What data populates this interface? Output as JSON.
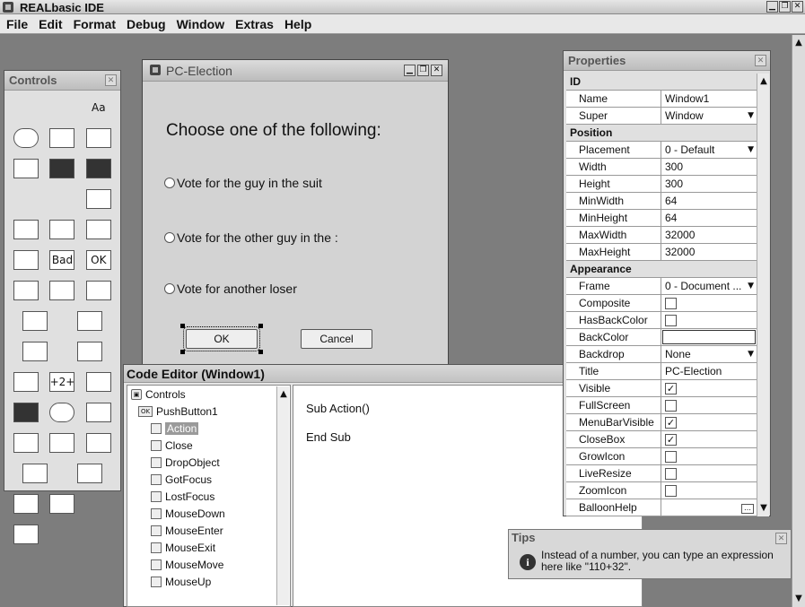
{
  "app": {
    "title": "REALbasic IDE"
  },
  "menu": [
    "File",
    "Edit",
    "Format",
    "Debug",
    "Window",
    "Extras",
    "Help"
  ],
  "palette": {
    "title": "Controls",
    "rows": [
      [
        "line-tool",
        "line-icon",
        "text-label-icon"
      ],
      [
        "oval-icon",
        "rounded-rect-icon",
        "rectangle-icon"
      ],
      [
        "canvas-icon",
        "imagewell-icon",
        "image-icon"
      ],
      [
        "disclosure-icon",
        "disclosure-open-icon",
        "editfield-icon"
      ],
      [
        "scrollbar-icon",
        "popup-menu-icon",
        "slider-icon"
      ],
      [
        "up-down-arrows-icon",
        "bevel-button-icon",
        "push-button-icon"
      ],
      [
        "combobox-icon",
        "listbox-icon",
        "listbox-columns-icon"
      ],
      [
        "checkbox-icon",
        "radio-button-icon"
      ],
      [
        "progress-wheel-icon",
        "progress-bar-icon"
      ],
      [
        "groupbox-icon",
        "tab-panel-icon",
        "page-panel-icon"
      ],
      [
        "movie-icon",
        "ball-icon",
        "timer-display-icon"
      ],
      [
        "serial-icon",
        "tabpanel-icon",
        "contextual-icon"
      ],
      [
        "database-query-icon",
        "database-icon"
      ],
      [
        "socket-icon",
        "calculator-icon",
        "timer-icon"
      ],
      [
        "spritesurface-icon",
        "plugin-icon",
        "globe-icon"
      ]
    ],
    "glyphs": {
      "text-label-icon": "Aa",
      "bevel-button-icon": "Bad",
      "push-button-icon": "OK",
      "tab-panel-icon": "+2+"
    }
  },
  "dialog": {
    "title": "PC-Election",
    "question": "Choose one of the following:",
    "options": [
      "Vote for the guy in the suit",
      "Vote for the other guy in the :",
      "Vote for another loser"
    ],
    "ok_label": "OK",
    "cancel_label": "Cancel"
  },
  "code_editor": {
    "title": "Code Editor (Window1)",
    "tree": {
      "root": "Controls",
      "control": "PushButton1",
      "events": [
        "Action",
        "Close",
        "DropObject",
        "GotFocus",
        "LostFocus",
        "MouseDown",
        "MouseEnter",
        "MouseExit",
        "MouseMove",
        "MouseUp"
      ],
      "selected": "Action"
    },
    "code_lines": [
      "Sub Action()",
      "End Sub"
    ]
  },
  "properties": {
    "title": "Properties",
    "rows": [
      {
        "section": "ID"
      },
      {
        "key": "Name",
        "value": "Window1"
      },
      {
        "key": "Super",
        "value": "Window",
        "dropdown": true
      },
      {
        "section": "Position"
      },
      {
        "key": "Placement",
        "value": "0 - Default",
        "dropdown": true
      },
      {
        "key": "Width",
        "value": "300"
      },
      {
        "key": "Height",
        "value": "300"
      },
      {
        "key": "MinWidth",
        "value": "64"
      },
      {
        "key": "MinHeight",
        "value": "64"
      },
      {
        "key": "MaxWidth",
        "value": "32000"
      },
      {
        "key": "MaxHeight",
        "value": "32000"
      },
      {
        "section": "Appearance"
      },
      {
        "key": "Frame",
        "value": "0 - Document ...",
        "dropdown": true
      },
      {
        "key": "Composite",
        "checkbox": false
      },
      {
        "key": "HasBackColor",
        "checkbox": false
      },
      {
        "key": "BackColor",
        "value": "",
        "swatch": true
      },
      {
        "key": "Backdrop",
        "value": "None",
        "dropdown": true
      },
      {
        "key": "Title",
        "value": "PC-Election"
      },
      {
        "key": "Visible",
        "checkbox": true
      },
      {
        "key": "FullScreen",
        "checkbox": false
      },
      {
        "key": "MenuBarVisible",
        "checkbox": true
      },
      {
        "key": "CloseBox",
        "checkbox": true
      },
      {
        "key": "GrowIcon",
        "checkbox": false
      },
      {
        "key": "LiveResize",
        "checkbox": false
      },
      {
        "key": "ZoomIcon",
        "checkbox": false
      },
      {
        "key": "BalloonHelp",
        "value": "",
        "ellipsis": true
      }
    ]
  },
  "tips": {
    "title": "Tips",
    "text": "Instead of a number, you can type an expression here like \"110+32\"."
  }
}
